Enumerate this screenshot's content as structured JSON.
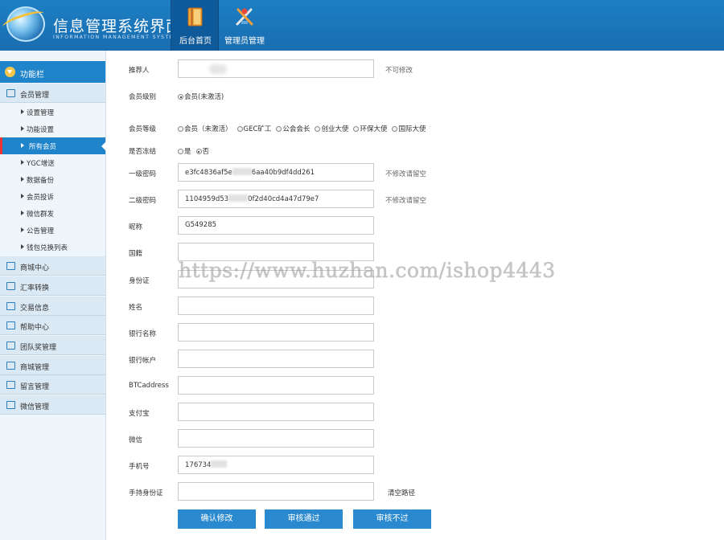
{
  "header": {
    "title": "信息管理系统界面",
    "subtitle": "INFORMATION MANAGEMENT SYSTEM GUI",
    "nav": [
      {
        "label": "后台首页",
        "icon": "book-icon",
        "active": true
      },
      {
        "label": "管理员管理",
        "icon": "admin-tools-icon",
        "active": false
      }
    ]
  },
  "sidebar": {
    "top": {
      "label": "功能栏"
    },
    "groups": [
      {
        "label": "会员管理",
        "expanded": true
      },
      {
        "label": "商城中心"
      },
      {
        "label": "汇率转换"
      },
      {
        "label": "交易信息"
      },
      {
        "label": "帮助中心"
      },
      {
        "label": "团队奖管理"
      },
      {
        "label": "商城管理"
      },
      {
        "label": "留言管理"
      },
      {
        "label": "微信管理"
      }
    ],
    "subitems": [
      {
        "label": "设置管理"
      },
      {
        "label": "功能设置"
      },
      {
        "label": "所有会员",
        "active": true
      },
      {
        "label": "YGC增送"
      },
      {
        "label": "数据备份"
      },
      {
        "label": "会员投诉"
      },
      {
        "label": "微信群发"
      },
      {
        "label": "公告管理"
      },
      {
        "label": "钱包兑换列表"
      }
    ]
  },
  "form": {
    "referrer": {
      "label": "推荐人",
      "value": "",
      "hint": "不可修改"
    },
    "member_rank": {
      "label": "会员级别",
      "option": "会员(未激活)"
    },
    "member_grade": {
      "label": "会员等级",
      "options": [
        "会员（未激活）",
        "GEC矿工",
        "公会会长",
        "创业大使",
        "环保大使",
        "国际大使"
      ],
      "selected_index": -1
    },
    "frozen": {
      "label": "是否冻结",
      "options": [
        "是",
        "否"
      ],
      "selected_index": 1
    },
    "pwd1": {
      "label": "一级密码",
      "value": "e3fc4836af5e",
      "value2": "6aa40b9df4dd261",
      "hint": "不修改请留空"
    },
    "pwd2": {
      "label": "二级密码",
      "value": "1104959d53",
      "value2": "0f2d40cd4a47d79e7",
      "hint": "不修改请留空"
    },
    "nickname": {
      "label": "昵称",
      "value": "G549285"
    },
    "nationality": {
      "label": "国籍",
      "value": ""
    },
    "id_card": {
      "label": "身份证",
      "value": ""
    },
    "name": {
      "label": "姓名",
      "value": ""
    },
    "bank_name": {
      "label": "银行名称",
      "value": ""
    },
    "bank_account": {
      "label": "银行帐户",
      "value": ""
    },
    "btc_address": {
      "label": "BTCaddress",
      "value": ""
    },
    "alipay": {
      "label": "支付宝",
      "value": ""
    },
    "wechat": {
      "label": "微信",
      "value": ""
    },
    "phone": {
      "label": "手机号",
      "value": "176734"
    },
    "handheld_id": {
      "label": "手持身份证",
      "value": "",
      "link": "清空路径"
    }
  },
  "buttons": {
    "confirm": "确认修改",
    "approve": "审核通过",
    "reject": "审核不过"
  },
  "watermark": "https://www.huzhan.com/ishop4443",
  "colors": {
    "header": "#1a6db0",
    "accent": "#1f84c9",
    "button": "#2b89cf",
    "sidebar_bg": "#eef5fb"
  }
}
